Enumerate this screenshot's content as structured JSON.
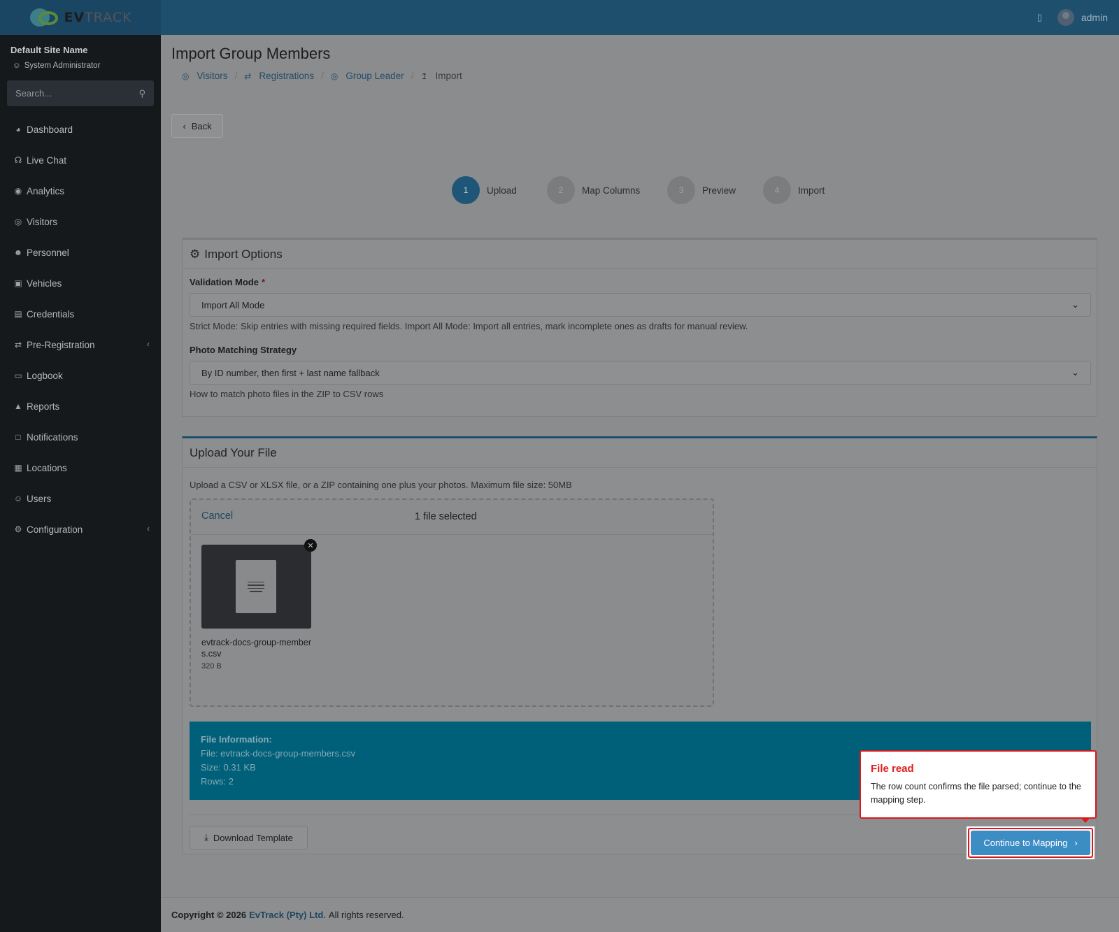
{
  "brand": {
    "name_bold": "EV",
    "name_rest": "TRACK"
  },
  "header": {
    "user_name": "admin"
  },
  "sidebar": {
    "site_name": "Default Site Name",
    "role": "System Administrator",
    "search_placeholder": "Search...",
    "items": [
      {
        "label": "Dashboard",
        "icon": "gauge-icon"
      },
      {
        "label": "Live Chat",
        "icon": "headset-icon"
      },
      {
        "label": "Analytics",
        "icon": "target-icon"
      },
      {
        "label": "Visitors",
        "icon": "eye-icon"
      },
      {
        "label": "Personnel",
        "icon": "users-icon"
      },
      {
        "label": "Vehicles",
        "icon": "car-icon"
      },
      {
        "label": "Credentials",
        "icon": "id-card-icon"
      },
      {
        "label": "Pre-Registration",
        "icon": "swap-icon",
        "expandable": true
      },
      {
        "label": "Logbook",
        "icon": "book-icon"
      },
      {
        "label": "Reports",
        "icon": "chart-icon"
      },
      {
        "label": "Notifications",
        "icon": "chat-icon"
      },
      {
        "label": "Locations",
        "icon": "map-icon"
      },
      {
        "label": "Users",
        "icon": "user-gear-icon"
      },
      {
        "label": "Configuration",
        "icon": "gear-icon",
        "expandable": true
      }
    ]
  },
  "page": {
    "title": "Import Group Members",
    "breadcrumb": [
      "Visitors",
      "Registrations",
      "Group Leader",
      "Import"
    ],
    "back_label": "Back"
  },
  "stepper": [
    {
      "num": "1",
      "label": "Upload",
      "active": true
    },
    {
      "num": "2",
      "label": "Map Columns",
      "active": false
    },
    {
      "num": "3",
      "label": "Preview",
      "active": false
    },
    {
      "num": "4",
      "label": "Import",
      "active": false
    }
  ],
  "import_options": {
    "title": "Import Options",
    "validation_label": "Validation Mode",
    "required_mark": "*",
    "validation_value": "Import All Mode",
    "validation_help": "Strict Mode: Skip entries with missing required fields. Import All Mode: Import all entries, mark incomplete ones as drafts for manual review.",
    "photo_label": "Photo Matching Strategy",
    "photo_value": "By ID number, then first + last name fallback",
    "photo_help": "How to match photo files in the ZIP to CSV rows"
  },
  "upload": {
    "title": "Upload Your File",
    "help": "Upload a CSV or XLSX file, or a ZIP containing one plus your photos. Maximum file size: 50MB",
    "cancel_label": "Cancel",
    "selected_count": "1 file selected",
    "file_name": "evtrack-docs-group-members.csv",
    "file_size": "320 B",
    "info_title": "File Information:",
    "info_file": "File: evtrack-docs-group-members.csv",
    "info_size": "Size: 0.31 KB",
    "info_rows": "Rows: 2",
    "download_label": "Download Template",
    "continue_label": "Continue to Mapping"
  },
  "tooltip": {
    "title": "File read",
    "body": "The row count confirms the file parsed; continue to the mapping step."
  },
  "footer": {
    "copyright": "Copyright © 2026",
    "company": "EvTrack (Pty) Ltd.",
    "rights": "All rights reserved."
  },
  "colors": {
    "accent": "#3d8dc5",
    "highlight": "#d91a1a",
    "info_box": "#00607a"
  }
}
